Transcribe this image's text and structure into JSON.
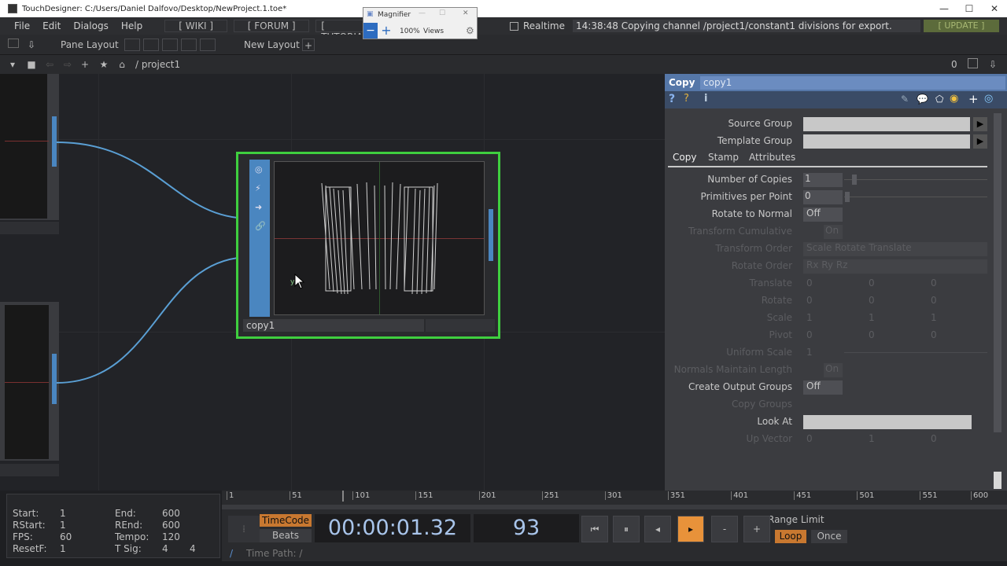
{
  "window": {
    "title": "TouchDesigner: C:/Users/Daniel Dalfovo/Desktop/NewProject.1.toe*",
    "min": "—",
    "max": "☐",
    "close": "✕"
  },
  "menu": {
    "items": [
      "File",
      "Edit",
      "Dialogs",
      "Help"
    ],
    "wiki": "[ WIKI ]",
    "forum": "[ FORUM ]",
    "tutorials": "[ TUTORIA",
    "realtime": "Realtime",
    "status": "14:38:48 Copying channel /project1/constant1 divisions for export.",
    "update": "[ UPDATE ]"
  },
  "magnifier": {
    "title": "Magnifier",
    "zoom": "100%",
    "views": "Views"
  },
  "panebar": {
    "pane_layout": "Pane Layout",
    "new_layout": "New Layout"
  },
  "pathbar": {
    "path": "/ project1",
    "counter": "0"
  },
  "network": {
    "node_name": "copy1"
  },
  "params": {
    "op_type": "Copy",
    "op_name": "copy1",
    "source_group": "Source Group",
    "template_group": "Template Group",
    "tabs": [
      "Copy",
      "Stamp",
      "Attributes"
    ],
    "number_of_copies": {
      "label": "Number of Copies",
      "value": "1"
    },
    "primitives_per_point": {
      "label": "Primitives per Point",
      "value": "0"
    },
    "rotate_to_normal": {
      "label": "Rotate to Normal",
      "value": "Off"
    },
    "transform_cumulative": {
      "label": "Transform Cumulative",
      "value": "On"
    },
    "transform_order": {
      "label": "Transform Order",
      "value": "Scale Rotate Translate"
    },
    "rotate_order": {
      "label": "Rotate Order",
      "value": "Rx Ry Rz"
    },
    "translate": {
      "label": "Translate",
      "values": [
        "0",
        "0",
        "0"
      ]
    },
    "rotate": {
      "label": "Rotate",
      "values": [
        "0",
        "0",
        "0"
      ]
    },
    "scale": {
      "label": "Scale",
      "values": [
        "1",
        "1",
        "1"
      ]
    },
    "pivot": {
      "label": "Pivot",
      "values": [
        "0",
        "0",
        "0"
      ]
    },
    "uniform_scale": {
      "label": "Uniform Scale",
      "value": "1"
    },
    "normals_maintain_length": {
      "label": "Normals Maintain Length",
      "value": "On"
    },
    "create_output_groups": {
      "label": "Create Output Groups",
      "value": "Off"
    },
    "copy_groups": {
      "label": "Copy Groups"
    },
    "look_at": {
      "label": "Look At"
    },
    "up_vector": {
      "label": "Up Vector",
      "values": [
        "0",
        "1",
        "0"
      ]
    }
  },
  "timeline": {
    "ticks": [
      "1",
      "51",
      "101",
      "151",
      "201",
      "251",
      "301",
      "351",
      "401",
      "451",
      "501",
      "551",
      "600"
    ],
    "playhead_frame": 93
  },
  "range": {
    "start_label": "Start:",
    "start": "1",
    "end_label": "End:",
    "end": "600",
    "rstart_label": "RStart:",
    "rstart": "1",
    "rend_label": "REnd:",
    "rend": "600",
    "fps_label": "FPS:",
    "fps": "60",
    "tempo_label": "Tempo:",
    "tempo": "120",
    "resetf_label": "ResetF:",
    "resetf": "1",
    "tsig_label": "T Sig:",
    "tsig_a": "4",
    "tsig_b": "4"
  },
  "transport": {
    "timecode_label": "TimeCode",
    "beats_label": "Beats",
    "timecode": "00:00:01.32",
    "frame": "93",
    "minus": "-",
    "plus": "+",
    "range_limit": "Range Limit",
    "loop": "Loop",
    "once": "Once",
    "time_path_label": "Time Path: /",
    "root": "/"
  },
  "colors": {
    "node_select": "#3fcf3f",
    "wire": "#5a9fd4",
    "param_header": "#5577a8",
    "orange": "#e8923a"
  }
}
